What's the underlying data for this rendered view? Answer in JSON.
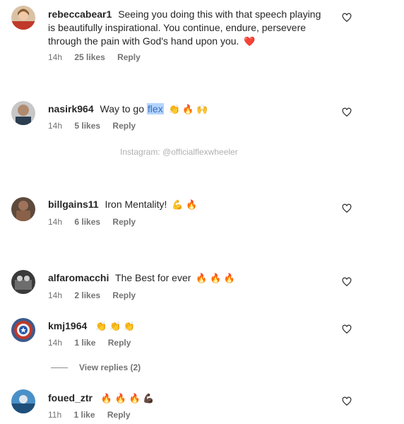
{
  "comments": [
    {
      "username": "rebeccabear1",
      "text": "Seeing you doing this with that speech playing is beautifully inspirational. You continue, endure, persevere through the pain with God's hand upon you.",
      "emoji": "❤️",
      "time": "14h",
      "likes": "25 likes",
      "reply": "Reply"
    },
    {
      "username": "nasirk964",
      "text": "Way to go",
      "highlight": "flex",
      "emoji": "👏 🔥 🙌",
      "time": "14h",
      "likes": "5 likes",
      "reply": "Reply"
    },
    {
      "username": "billgains11",
      "text": "Iron Mentality!",
      "emoji": "💪 🔥",
      "time": "14h",
      "likes": "6 likes",
      "reply": "Reply"
    },
    {
      "username": "alfaromacchi",
      "text": "The Best for ever",
      "emoji": "🔥 🔥 🔥",
      "time": "14h",
      "likes": "2 likes",
      "reply": "Reply"
    },
    {
      "username": "kmj1964",
      "text": "",
      "emoji": "👏 👏 👏",
      "time": "14h",
      "likes": "1 like",
      "reply": "Reply"
    },
    {
      "username": "foued_ztr",
      "text": "",
      "emoji": "🔥 🔥 🔥 💪🏿",
      "time": "11h",
      "likes": "1 like",
      "reply": "Reply"
    }
  ],
  "watermark": "Instagram: @officialflexwheeler",
  "view_replies": "View replies (2)",
  "icons": {
    "like": "heart-outline-icon"
  },
  "colors": {
    "heart_red": "#e0245e",
    "meta_gray": "#737373",
    "highlight_bg": "#b3d4ff"
  }
}
